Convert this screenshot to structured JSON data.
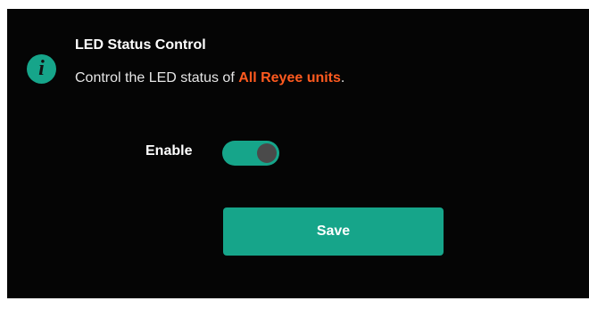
{
  "notice": {
    "icon": "info-icon",
    "icon_glyph": "i",
    "title": "LED Status Control",
    "desc_prefix": "Control the LED status of ",
    "desc_highlight": "All Reyee units",
    "desc_suffix": "."
  },
  "form": {
    "enable_label": "Enable",
    "enable_state": "on",
    "save_label": "Save"
  },
  "colors": {
    "panel_bg": "#050505",
    "accent": "#16a58a",
    "highlight": "#ff5a1f",
    "knob": "#4a4a4a"
  }
}
